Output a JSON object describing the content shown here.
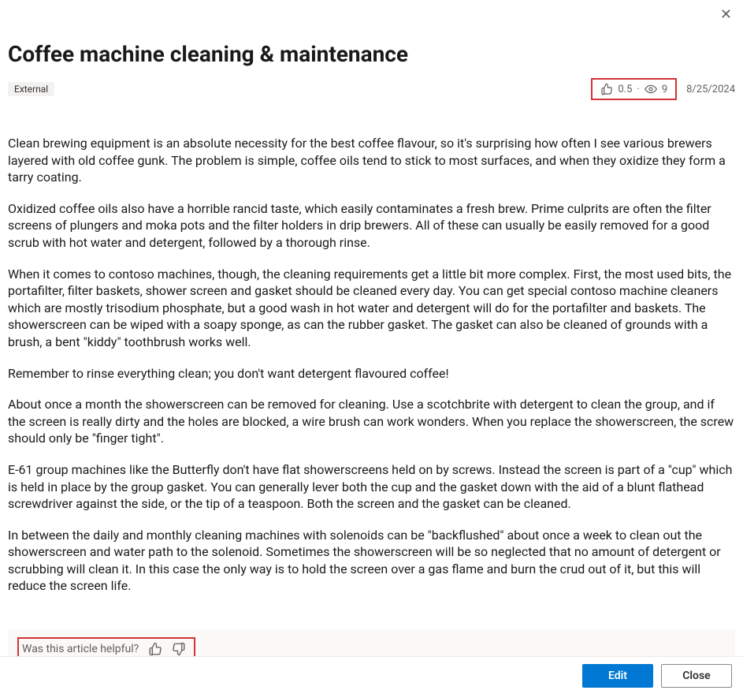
{
  "header": {
    "title": "Coffee machine cleaning & maintenance",
    "badge": "External"
  },
  "stats": {
    "likes": "0.5",
    "views": "9",
    "date": "8/25/2024"
  },
  "article": {
    "paragraphs": [
      "Clean brewing equipment is an absolute necessity for the best coffee flavour, so it's surprising how often I see various brewers layered with old coffee gunk. The problem is simple, coffee oils tend to stick to most surfaces, and when they oxidize they form a tarry coating.",
      "Oxidized coffee oils also have a horrible rancid taste, which easily contaminates a fresh brew. Prime culprits are often the filter screens of plungers and moka pots and the filter holders in drip brewers. All of these can usually be easily removed for a good scrub with hot water and detergent, followed by a thorough rinse.",
      "When it comes to contoso machines, though, the cleaning requirements get a little bit more complex. First, the most used bits, the portafilter, filter baskets, shower screen and gasket should be cleaned every day. You can get special contoso machine cleaners which are mostly trisodium phosphate, but a good wash in hot water and detergent will do for the portafilter and baskets. The showerscreen can be wiped with a soapy sponge, as can the rubber gasket. The gasket can also be cleaned of grounds with a brush, a bent \"kiddy\" toothbrush works well.",
      "Remember to rinse everything clean; you don't want detergent flavoured coffee!",
      "About once a month the showerscreen can be removed for cleaning. Use a scotchbrite with detergent to clean the group, and if the screen is really dirty and the holes are blocked, a wire brush can work wonders. When you replace the showerscreen, the screw should only be \"finger tight\".",
      "E-61 group machines like the Butterfly don't have flat showerscreens held on by screws. Instead the screen is part of a \"cup\" which is held in place by the group gasket. You can generally lever both the cup and the gasket down with the aid of a blunt flathead screwdriver against the side, or the tip of a teaspoon. Both the screen and the gasket can be cleaned.",
      "In between the daily and monthly cleaning machines with solenoids can be \"backflushed\" about once a week to clean out the showerscreen and water path to the solenoid. Sometimes the showerscreen will be so neglected that no amount of detergent or scrubbing will clean it. In this case the only way is to hold the screen over a gas flame and burn the crud out of it, but this will reduce the screen life."
    ]
  },
  "helpful": {
    "prompt": "Was this article helpful?"
  },
  "footer": {
    "edit_label": "Edit",
    "close_label": "Close"
  }
}
